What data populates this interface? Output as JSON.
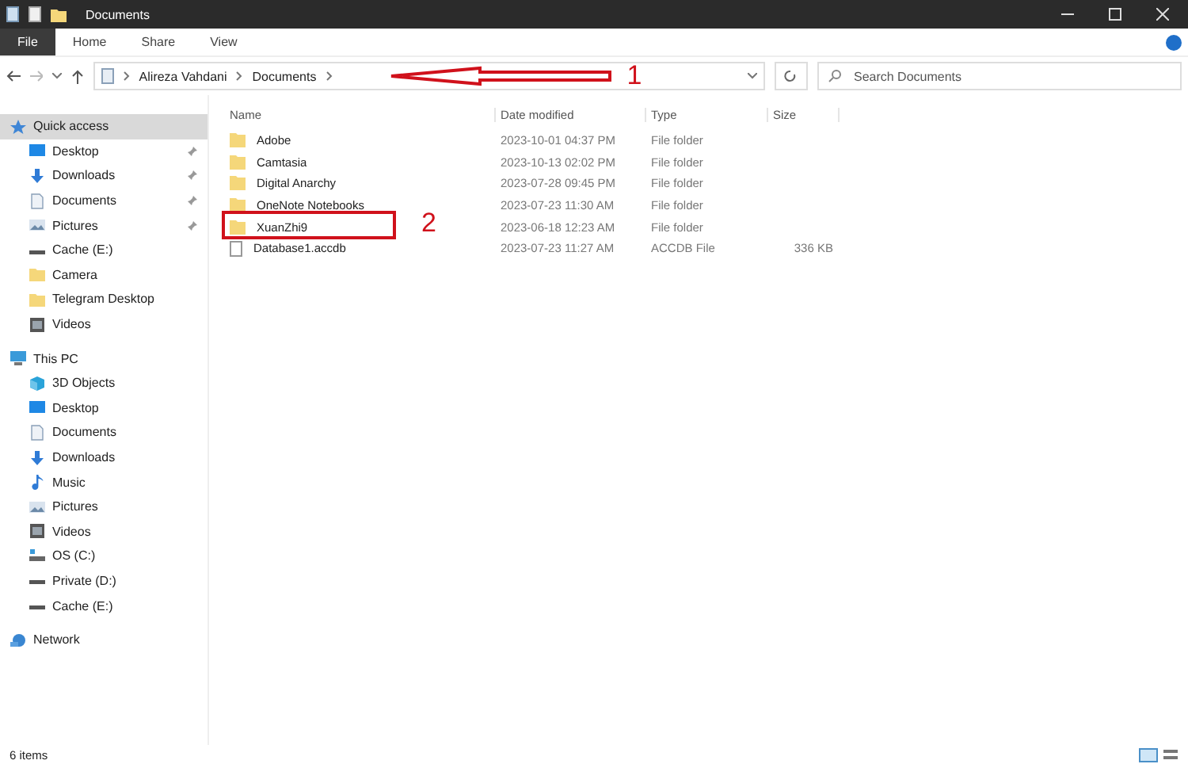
{
  "window": {
    "title": "Documents"
  },
  "ribbon_tabs": [
    {
      "label": "File",
      "selected": true
    },
    {
      "label": "Home",
      "selected": false
    },
    {
      "label": "Share",
      "selected": false
    },
    {
      "label": "View",
      "selected": false
    }
  ],
  "address_bar": {
    "segments": [
      "Alireza Vahdani",
      "Documents"
    ],
    "callout": "1"
  },
  "search": {
    "placeholder": "Search Documents"
  },
  "sidebar": {
    "items": [
      {
        "label": "Quick access",
        "kind": "star",
        "selected": true,
        "children": [
          {
            "label": "Desktop",
            "kind": "desktop",
            "pinned": true,
            "selected": false
          },
          {
            "label": "Downloads",
            "kind": "download",
            "pinned": true,
            "selected": false
          },
          {
            "label": "Documents",
            "kind": "document",
            "pinned": true,
            "selected": false
          },
          {
            "label": "Pictures",
            "kind": "pictures",
            "pinned": true,
            "selected": false
          },
          {
            "label": "Cache (E:)",
            "kind": "drive",
            "pinned": false,
            "selected": false
          },
          {
            "label": "Camera",
            "kind": "folder",
            "pinned": false,
            "selected": false
          },
          {
            "label": "Telegram Desktop",
            "kind": "folder",
            "pinned": false,
            "selected": false
          },
          {
            "label": "Videos",
            "kind": "video",
            "pinned": false,
            "selected": false
          }
        ]
      },
      {
        "label": "This PC",
        "kind": "pc",
        "selected": false,
        "children": [
          {
            "label": "3D Objects",
            "kind": "cube",
            "pinned": false,
            "selected": false
          },
          {
            "label": "Desktop",
            "kind": "desktop",
            "pinned": false,
            "selected": false
          },
          {
            "label": "Documents",
            "kind": "document",
            "pinned": false,
            "selected": false
          },
          {
            "label": "Downloads",
            "kind": "download",
            "pinned": false,
            "selected": false
          },
          {
            "label": "Music",
            "kind": "music",
            "pinned": false,
            "selected": false
          },
          {
            "label": "Pictures",
            "kind": "pictures",
            "pinned": false,
            "selected": false
          },
          {
            "label": "Videos",
            "kind": "video",
            "pinned": false,
            "selected": false
          },
          {
            "label": "OS (C:)",
            "kind": "os",
            "pinned": false,
            "selected": false
          },
          {
            "label": "Private (D:)",
            "kind": "drive",
            "pinned": false,
            "selected": false
          },
          {
            "label": "Cache (E:)",
            "kind": "drive",
            "pinned": false,
            "selected": false
          }
        ]
      },
      {
        "label": "Network",
        "kind": "network",
        "selected": false
      }
    ]
  },
  "table": {
    "columns": [
      "Name",
      "Date modified",
      "Type",
      "Size"
    ],
    "rows": [
      {
        "kind": "folder",
        "name": "Adobe",
        "date": "2023-10-01 04:37 PM",
        "type": "File folder"
      },
      {
        "kind": "folder",
        "name": "Camtasia",
        "date": "2023-10-13 02:02 PM",
        "type": "File folder"
      },
      {
        "kind": "folder",
        "name": "Digital Anarchy",
        "date": "2023-07-28 09:45 PM",
        "type": "File folder"
      },
      {
        "kind": "folder",
        "name": "OneNote Notebooks",
        "date": "2023-07-23 11:30 AM",
        "type": "File folder"
      },
      {
        "kind": "folder",
        "name": "XuanZhi9",
        "date": "2023-06-18 12:23 AM",
        "type": "File folder",
        "callout": "2"
      },
      {
        "kind": "file",
        "name": "Database1.accdb",
        "date": "2023-07-23 11:27 AM",
        "type": "ACCDB File",
        "size": "336 KB"
      }
    ]
  },
  "status_bar": {
    "count": "6 items"
  }
}
